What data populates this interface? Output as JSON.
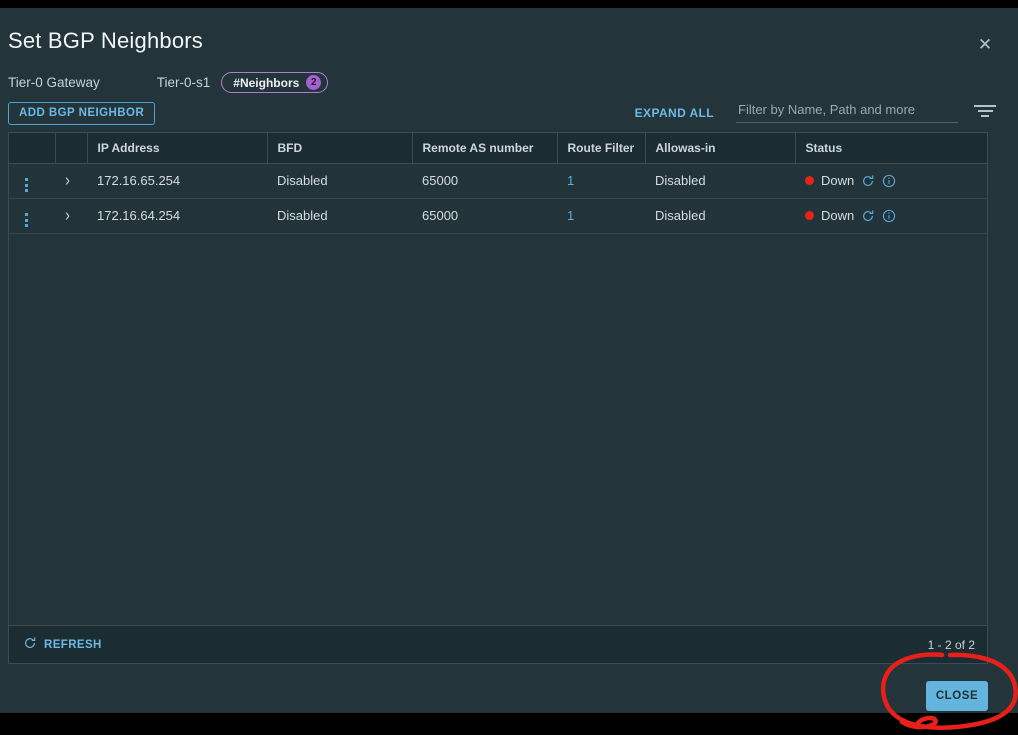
{
  "dialog": {
    "title": "Set BGP Neighbors",
    "close_icon": "close-x-icon"
  },
  "breadcrumb": {
    "gateway_label": "Tier-0 Gateway",
    "gateway_name": "Tier-0-s1",
    "badge_label": "#Neighbors",
    "badge_count": "2"
  },
  "toolbar": {
    "add_button": "ADD BGP NEIGHBOR",
    "expand_all": "EXPAND ALL",
    "filter_placeholder": "Filter by Name, Path and more",
    "filter_value": "",
    "filter_icon": "funnel-icon"
  },
  "table": {
    "columns": [
      "",
      "",
      "IP Address",
      "BFD",
      "Remote AS number",
      "Route Filter",
      "Allowas-in",
      "Status"
    ],
    "rows": [
      {
        "actions_icon": "kebab-menu-icon",
        "expand_icon": "chevron-right-icon",
        "ip_address": "172.16.65.254",
        "bfd": "Disabled",
        "remote_as_number": "65000",
        "route_filter": "1",
        "allowas_in": "Disabled",
        "status": "Down",
        "status_color": "#e62415",
        "status_refresh_icon": "refresh-icon",
        "status_info_icon": "info-circle-icon"
      },
      {
        "actions_icon": "kebab-menu-icon",
        "expand_icon": "chevron-right-icon",
        "ip_address": "172.16.64.254",
        "bfd": "Disabled",
        "remote_as_number": "65000",
        "route_filter": "1",
        "allowas_in": "Disabled",
        "status": "Down",
        "status_color": "#e62415",
        "status_refresh_icon": "refresh-icon",
        "status_info_icon": "info-circle-icon"
      }
    ],
    "footer": {
      "refresh_label": "REFRESH",
      "refresh_icon": "refresh-icon",
      "pagination": "1 - 2 of 2"
    }
  },
  "actions": {
    "close_button": "CLOSE"
  },
  "annotation": {
    "type": "hand-drawn-red-circle",
    "color": "#e8201a",
    "target": "CLOSE"
  },
  "colors": {
    "accent": "#6cb9e3",
    "modal_bg": "#23353b",
    "header_bg": "#1b2c33",
    "badge_purple": "#a45fd0",
    "status_down": "#e62415"
  }
}
